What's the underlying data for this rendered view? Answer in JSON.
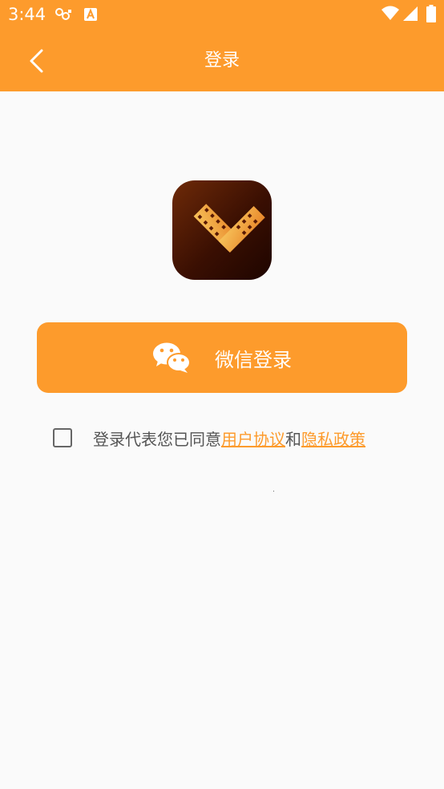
{
  "status_bar": {
    "time": "3:44"
  },
  "app_bar": {
    "title": "登录"
  },
  "login": {
    "wechat_label": "微信登录"
  },
  "agreement": {
    "prefix": "登录代表您已同意",
    "user_agreement": "用户协议",
    "and": "和",
    "privacy_policy": "隐私政策"
  },
  "colors": {
    "accent": "#fd9b2c",
    "background": "#fafafa",
    "logo_bg": "#3a0f02"
  },
  "icons": [
    "back-arrow-icon",
    "wechat-icon",
    "wifi-icon",
    "signal-icon",
    "battery-icon"
  ]
}
